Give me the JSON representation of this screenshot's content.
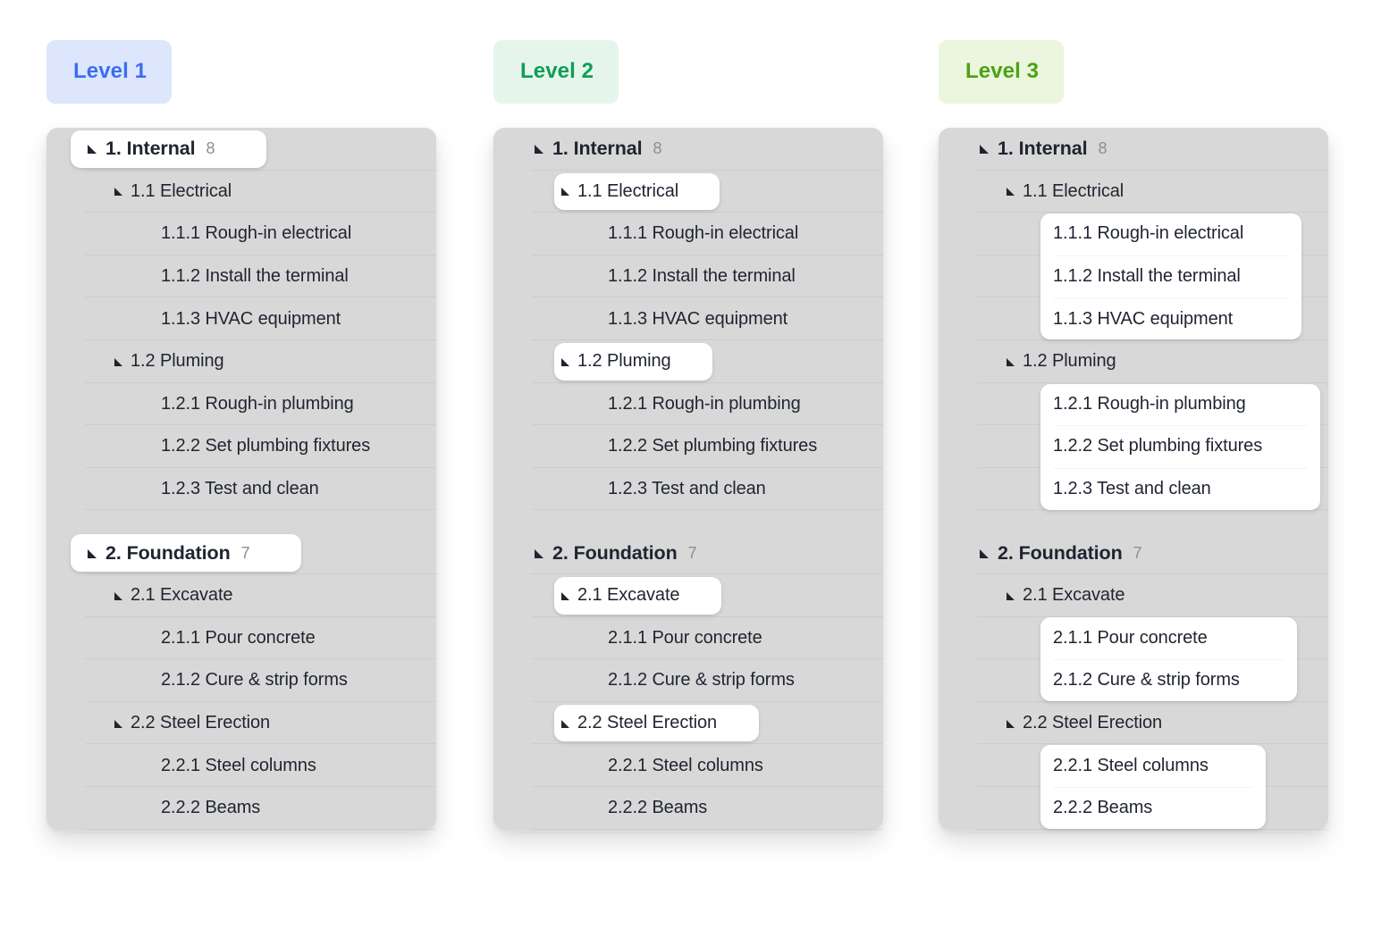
{
  "columns": [
    {
      "badge": "Level 1",
      "badge_bg": "#dde6fd",
      "badge_fg": "#3b6ef0",
      "highlight_mode": "level1",
      "groups": [
        {
          "header": {
            "label": "1. Internal",
            "count": "8",
            "depth": 1,
            "highlight": true
          },
          "children": [
            {
              "label": "1.1 Electrical",
              "depth": 2,
              "highlight": false,
              "leaves": [
                {
                  "label": "1.1.1 Rough-in electrical",
                  "depth": 3,
                  "highlight": false
                },
                {
                  "label": "1.1.2 Install the terminal",
                  "depth": 3,
                  "highlight": false
                },
                {
                  "label": "1.1.3 HVAC equipment",
                  "depth": 3,
                  "highlight": false
                }
              ]
            },
            {
              "label": "1.2 Pluming",
              "depth": 2,
              "highlight": false,
              "leaves": [
                {
                  "label": "1.2.1 Rough-in plumbing",
                  "depth": 3,
                  "highlight": false
                },
                {
                  "label": "1.2.2 Set plumbing fixtures",
                  "depth": 3,
                  "highlight": false
                },
                {
                  "label": "1.2.3 Test and clean",
                  "depth": 3,
                  "highlight": false
                }
              ]
            }
          ]
        },
        {
          "header": {
            "label": "2. Foundation",
            "count": "7",
            "depth": 1,
            "highlight": true
          },
          "children": [
            {
              "label": "2.1 Excavate",
              "depth": 2,
              "highlight": false,
              "leaves": [
                {
                  "label": "2.1.1 Pour concrete",
                  "depth": 3,
                  "highlight": false
                },
                {
                  "label": "2.1.2 Cure & strip forms",
                  "depth": 3,
                  "highlight": false
                }
              ]
            },
            {
              "label": "2.2 Steel Erection",
              "depth": 2,
              "highlight": false,
              "leaves": [
                {
                  "label": "2.2.1 Steel columns",
                  "depth": 3,
                  "highlight": false
                },
                {
                  "label": "2.2.2 Beams",
                  "depth": 3,
                  "highlight": false
                }
              ]
            }
          ]
        }
      ]
    },
    {
      "badge": "Level 2",
      "badge_bg": "#e6f5ec",
      "badge_fg": "#0f9d58",
      "highlight_mode": "level2",
      "groups": [
        {
          "header": {
            "label": "1. Internal",
            "count": "8",
            "depth": 1,
            "highlight": false
          },
          "children": [
            {
              "label": "1.1 Electrical",
              "depth": 2,
              "highlight": true,
              "leaves": [
                {
                  "label": "1.1.1 Rough-in electrical",
                  "depth": 3,
                  "highlight": false
                },
                {
                  "label": "1.1.2 Install the terminal",
                  "depth": 3,
                  "highlight": false
                },
                {
                  "label": "1.1.3 HVAC equipment",
                  "depth": 3,
                  "highlight": false
                }
              ]
            },
            {
              "label": "1.2 Pluming",
              "depth": 2,
              "highlight": true,
              "leaves": [
                {
                  "label": "1.2.1 Rough-in plumbing",
                  "depth": 3,
                  "highlight": false
                },
                {
                  "label": "1.2.2 Set plumbing fixtures",
                  "depth": 3,
                  "highlight": false
                },
                {
                  "label": "1.2.3 Test and clean",
                  "depth": 3,
                  "highlight": false
                }
              ]
            }
          ]
        },
        {
          "header": {
            "label": "2. Foundation",
            "count": "7",
            "depth": 1,
            "highlight": false
          },
          "children": [
            {
              "label": "2.1 Excavate",
              "depth": 2,
              "highlight": true,
              "leaves": [
                {
                  "label": "2.1.1 Pour concrete",
                  "depth": 3,
                  "highlight": false
                },
                {
                  "label": "2.1.2 Cure & strip forms",
                  "depth": 3,
                  "highlight": false
                }
              ]
            },
            {
              "label": "2.2 Steel Erection",
              "depth": 2,
              "highlight": true,
              "leaves": [
                {
                  "label": "2.2.1 Steel columns",
                  "depth": 3,
                  "highlight": false
                },
                {
                  "label": "2.2.2 Beams",
                  "depth": 3,
                  "highlight": false
                }
              ]
            }
          ]
        }
      ]
    },
    {
      "badge": "Level 3",
      "badge_bg": "#ecf5dd",
      "badge_fg": "#4aa310",
      "highlight_mode": "level3",
      "groups": [
        {
          "header": {
            "label": "1. Internal",
            "count": "8",
            "depth": 1,
            "highlight": false
          },
          "children": [
            {
              "label": "1.1 Electrical",
              "depth": 2,
              "highlight": false,
              "leaves": [
                {
                  "label": "1.1.1 Rough-in electrical",
                  "depth": 3,
                  "highlight": true
                },
                {
                  "label": "1.1.2 Install the terminal",
                  "depth": 3,
                  "highlight": true
                },
                {
                  "label": "1.1.3 HVAC equipment",
                  "depth": 3,
                  "highlight": true
                }
              ]
            },
            {
              "label": "1.2 Pluming",
              "depth": 2,
              "highlight": false,
              "leaves": [
                {
                  "label": "1.2.1 Rough-in plumbing",
                  "depth": 3,
                  "highlight": true
                },
                {
                  "label": "1.2.2 Set plumbing fixtures",
                  "depth": 3,
                  "highlight": true
                },
                {
                  "label": "1.2.3 Test and clean",
                  "depth": 3,
                  "highlight": true
                }
              ]
            }
          ]
        },
        {
          "header": {
            "label": "2. Foundation",
            "count": "7",
            "depth": 1,
            "highlight": false
          },
          "children": [
            {
              "label": "2.1 Excavate",
              "depth": 2,
              "highlight": false,
              "leaves": [
                {
                  "label": "2.1.1 Pour concrete",
                  "depth": 3,
                  "highlight": true
                },
                {
                  "label": "2.1.2 Cure & strip forms",
                  "depth": 3,
                  "highlight": true
                }
              ]
            },
            {
              "label": "2.2 Steel Erection",
              "depth": 2,
              "highlight": false,
              "leaves": [
                {
                  "label": "2.2.1 Steel columns",
                  "depth": 3,
                  "highlight": true
                },
                {
                  "label": "2.2.2 Beams",
                  "depth": 3,
                  "highlight": true
                }
              ]
            }
          ]
        }
      ]
    }
  ],
  "icons": {
    "caret": "expanded-caret-icon"
  }
}
